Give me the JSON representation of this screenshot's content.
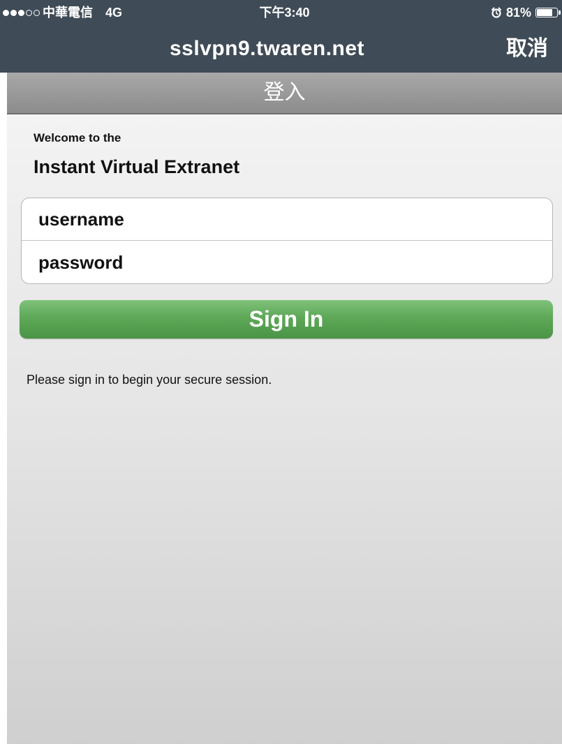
{
  "status_bar": {
    "signal_filled": 3,
    "signal_total": 5,
    "carrier": "中華電信",
    "network": "4G",
    "time": "下午3:40",
    "alarm_icon": "alarm-icon",
    "battery_percent": "81%",
    "battery_level": 0.81
  },
  "nav": {
    "title": "sslvpn9.twaren.net",
    "cancel_label": "取消"
  },
  "header": {
    "title": "登入"
  },
  "login": {
    "welcome_line1": "Welcome to the",
    "welcome_line2": "Instant Virtual Extranet",
    "username_placeholder": "username",
    "password_placeholder": "password",
    "signin_label": "Sign In",
    "info_text": "Please sign in to begin your secure session."
  },
  "colors": {
    "nav_background": "#3f4b56",
    "button_green": "#5ea858",
    "header_grey": "#9a9a9a"
  }
}
